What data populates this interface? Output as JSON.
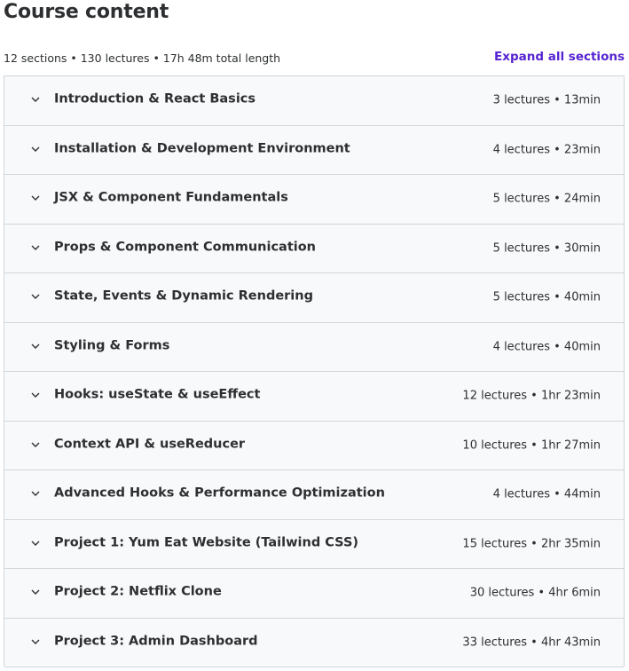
{
  "header": {
    "title": "Course content"
  },
  "summary": {
    "text": "12 sections • 130 lectures • 17h 48m total length",
    "expand_label": "Expand all sections"
  },
  "colors": {
    "accent": "#5624d0",
    "section_bg": "#f7f9fa",
    "border": "#d1d7dc",
    "text": "#2d2f31"
  },
  "sections": [
    {
      "title": "Introduction & React Basics",
      "meta": "3 lectures • 13min",
      "icon": "chevron-down-icon"
    },
    {
      "title": "Installation & Development Environment",
      "meta": "4 lectures • 23min",
      "icon": "chevron-down-icon"
    },
    {
      "title": "JSX & Component Fundamentals",
      "meta": "5 lectures • 24min",
      "icon": "chevron-down-icon"
    },
    {
      "title": "Props & Component Communication",
      "meta": "5 lectures • 30min",
      "icon": "chevron-down-icon"
    },
    {
      "title": "State, Events & Dynamic Rendering",
      "meta": "5 lectures • 40min",
      "icon": "chevron-down-icon"
    },
    {
      "title": "Styling & Forms",
      "meta": "4 lectures • 40min",
      "icon": "chevron-down-icon"
    },
    {
      "title": "Hooks: useState & useEffect",
      "meta": "12 lectures • 1hr 23min",
      "icon": "chevron-down-icon"
    },
    {
      "title": "Context API & useReducer",
      "meta": "10 lectures • 1hr 27min",
      "icon": "chevron-down-icon"
    },
    {
      "title": "Advanced Hooks & Performance Optimization",
      "meta": "4 lectures • 44min",
      "icon": "chevron-down-icon"
    },
    {
      "title": "Project 1: Yum Eat Website (Tailwind CSS)",
      "meta": "15 lectures • 2hr 35min",
      "icon": "chevron-down-icon"
    },
    {
      "title": "Project 2: Netflix Clone",
      "meta": "30 lectures • 4hr 6min",
      "icon": "chevron-down-icon"
    },
    {
      "title": "Project 3: Admin Dashboard",
      "meta": "33 lectures • 4hr 43min",
      "icon": "chevron-down-icon"
    }
  ]
}
